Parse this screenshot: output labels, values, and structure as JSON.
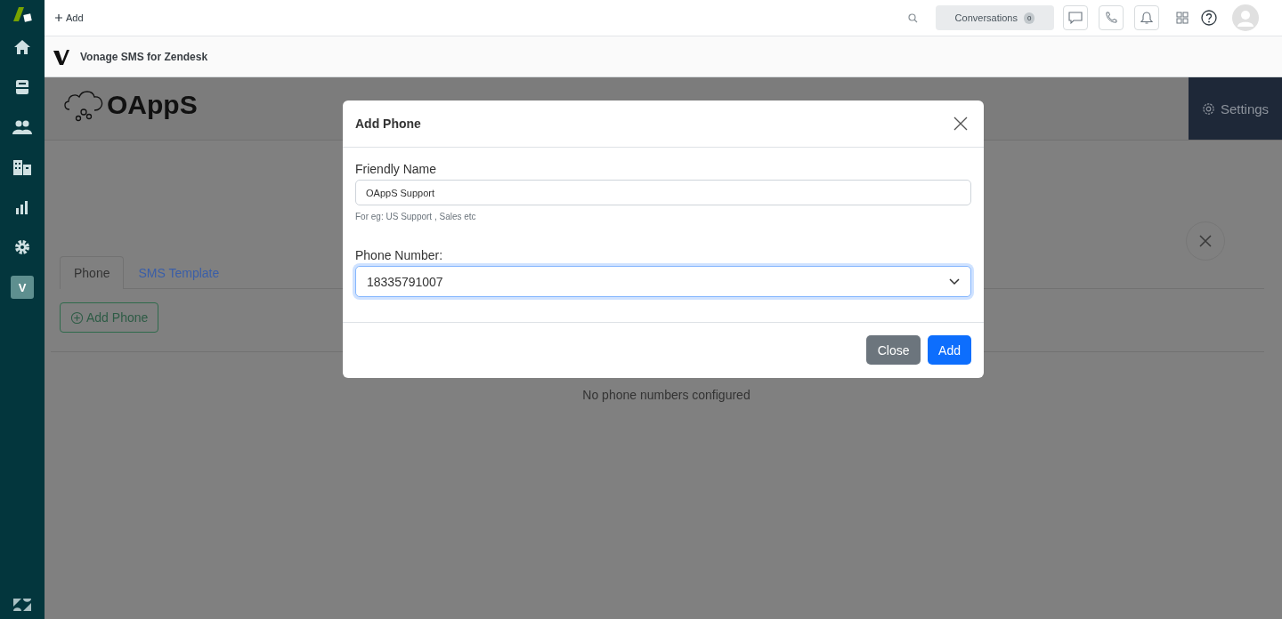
{
  "topbar": {
    "add_label": "Add",
    "conversations": {
      "label": "Conversations",
      "count": "0"
    }
  },
  "sidebar": {
    "items": [
      {
        "kind": "home",
        "selected": false
      },
      {
        "kind": "views",
        "selected": false
      },
      {
        "kind": "customers",
        "selected": false
      },
      {
        "kind": "organizations",
        "selected": false
      },
      {
        "kind": "reporting",
        "selected": false
      },
      {
        "kind": "admin",
        "selected": false
      },
      {
        "kind": "app",
        "label": "V",
        "selected": true
      }
    ]
  },
  "app_header": {
    "title": "Vonage SMS for Zendesk"
  },
  "app": {
    "brand": "OAppS",
    "settings_label": "Settings",
    "tabs": [
      {
        "label": "Phone",
        "selected": true
      },
      {
        "label": "SMS Template",
        "selected": false
      }
    ],
    "add_button": "Add Phone",
    "empty_message": "No phone numbers configured"
  },
  "modal": {
    "title": "Add Phone",
    "fields": [
      {
        "kind": "text",
        "label": "Friendly Name",
        "value": "OAppS Support",
        "help": "For eg: US Support , Sales etc",
        "focused": false
      },
      {
        "kind": "select",
        "label": "Phone Number:",
        "value": "18335791007",
        "focused": true
      }
    ],
    "buttons": [
      {
        "label": "Close",
        "kind": "secondary"
      },
      {
        "label": "Add",
        "kind": "primary"
      }
    ]
  }
}
